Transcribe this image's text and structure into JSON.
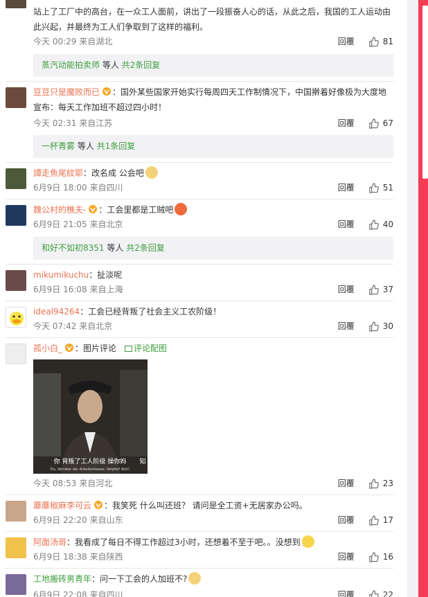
{
  "comments": [
    {
      "text": "站上了工厂中的高台，在一众工人面前，讲出了一段振奋人心的话，从此之后，我国的工人运动由此兴起，并最终为工人们争取到了这样的福利。",
      "time": "今天 00:29 来自湖北",
      "likes": "81",
      "sub": {
        "users": "蒸汽动能拍卖师",
        "mid": " 等人 ",
        "count": "共2条回复"
      }
    },
    {
      "user": "豆豆只是魔败而已",
      "text": "：国外某些国家开始实行每周四天工作制情况下，中国擀着好像极为大度地宣布：每天工作加班不超过四小时！",
      "time": "今天 02:31 来自江苏",
      "likes": "67",
      "sub": {
        "users": "一杯青雾",
        "mid": " 等人 ",
        "count": "共1条回复"
      }
    },
    {
      "user": "譚走魚尾紋耶",
      "text": "：改名成 公会吧",
      "time": "6月9日 18:00 来自四川",
      "likes": "51"
    },
    {
      "user": "魏公村的樵夫-",
      "text": "：工会里都是工贼吧",
      "time": "6月9日 21:05 来自北京",
      "likes": "40",
      "sub": {
        "users": "和好不如初8351",
        "mid": " 等人 ",
        "count": "共2条回复"
      }
    },
    {
      "user": "mikumikuchu",
      "text": "：扯淡呢",
      "time": "6月9日 16:08 来自上海",
      "likes": "37"
    },
    {
      "user": "ideal94264",
      "text": "：工会已经背叛了社会主义工农阶级！",
      "time": "今天 07:42 来自北京",
      "likes": "30"
    },
    {
      "user": "孤小白_",
      "text": "：图片评论",
      "pic_link": "评论配图",
      "time": "今天 08:53 来自河北",
      "likes": "23",
      "photo": {
        "caption_cn": "你 背叛了工人阶级 操你妈",
        "caption_de": "Du, Verräter der Arbeiterklasse. Verpfeif dich!",
        "corner": "知"
      }
    },
    {
      "user": "蘼蘼椒麻李可云",
      "text": "：我笑死 什么叫还班？ 请问是全工资+无居家办公吗。",
      "time": "6月9日 22:20 来自山东",
      "likes": "17"
    },
    {
      "user": "阿面汤哥",
      "text": "：我看成了每日不得工作超过3小时，还想着不至于吧。。没想到",
      "time": "6月9日 18:38 来自陕西",
      "likes": "16"
    },
    {
      "user": "工地搬砖男青年",
      "text": "：问一下工会的人加班不?",
      "time": "6月9日 22:08 来自四川",
      "likes": "22"
    }
  ],
  "ui": {
    "reply_label": "回覆",
    "accent": "#eb7350",
    "sidebar_color": "#f53d57"
  }
}
